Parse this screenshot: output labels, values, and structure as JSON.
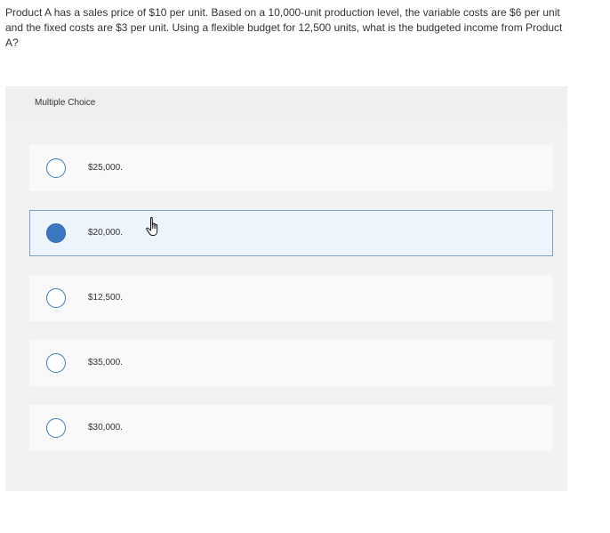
{
  "question": {
    "text": "Product A has a sales price of $10 per unit. Based on a 10,000-unit production level, the variable costs are $6 per unit and the fixed costs are $3 per unit. Using a flexible budget for 12,500 units, what is the budgeted income from Product A?"
  },
  "panel": {
    "title": "Multiple Choice"
  },
  "choices": [
    {
      "label": "$25,000.",
      "selected": false
    },
    {
      "label": "$20,000.",
      "selected": true
    },
    {
      "label": "$12,500.",
      "selected": false
    },
    {
      "label": "$35,000.",
      "selected": false
    },
    {
      "label": "$30,000.",
      "selected": false
    }
  ],
  "icons": {
    "cursor": "hand-pointer-icon",
    "radio": "radio-button-icon"
  },
  "colors": {
    "accent": "#3c78c2",
    "selected_background": "#edf4fc",
    "selected_border": "#7ea0c6",
    "panel_background": "#f2f2f2"
  }
}
